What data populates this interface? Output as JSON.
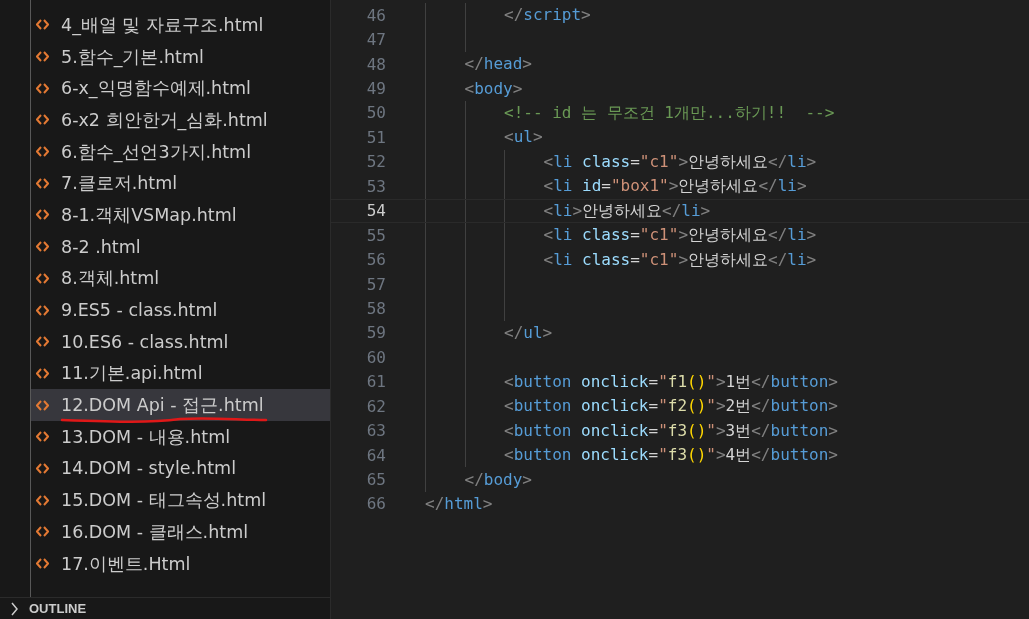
{
  "sidebar": {
    "files": [
      {
        "label": "4_배열 및 자료구조.html",
        "selected": false
      },
      {
        "label": "5.함수_기본.html",
        "selected": false
      },
      {
        "label": "6-x_익명함수예제.html",
        "selected": false
      },
      {
        "label": "6-x2 희안한거_심화.html",
        "selected": false
      },
      {
        "label": "6.함수_선언3가지.html",
        "selected": false
      },
      {
        "label": "7.클로저.html",
        "selected": false
      },
      {
        "label": "8-1.객체VSMap.html",
        "selected": false
      },
      {
        "label": "8-2 .html",
        "selected": false
      },
      {
        "label": "8.객체.html",
        "selected": false
      },
      {
        "label": "9.ES5 - class.html",
        "selected": false
      },
      {
        "label": "10.ES6 - class.html",
        "selected": false
      },
      {
        "label": "11.기본.api.html",
        "selected": false
      },
      {
        "label": "12.DOM Api - 접근.html",
        "selected": true
      },
      {
        "label": "13.DOM - 내용.html",
        "selected": false
      },
      {
        "label": "14.DOM - style.html",
        "selected": false
      },
      {
        "label": "15.DOM - 태그속성.html",
        "selected": false
      },
      {
        "label": "16.DOM - 클래스.html",
        "selected": false
      },
      {
        "label": "17.이벤트.Html",
        "selected": false
      }
    ],
    "outline": {
      "label": "OUTLINE",
      "expanded": false
    }
  },
  "editor": {
    "lines": [
      {
        "children": [
          {
            "children": [
              {
                "number": "46",
                "current": false,
                "tokens": [
                  {
                    "kind": "punct",
                    "text": "</"
                  },
                  {
                    "kind": "tag",
                    "text": "script"
                  },
                  {
                    "kind": "punct",
                    "text": ">"
                  }
                ]
              },
              {
                "number": "47",
                "current": false
              }
            ]
          },
          {
            "number": "48",
            "current": false,
            "tokens": [
              {
                "kind": "punct",
                "text": "</"
              },
              {
                "kind": "tag",
                "text": "head"
              },
              {
                "kind": "punct",
                "text": ">"
              }
            ]
          },
          {
            "number": "49",
            "current": false,
            "tokens": [
              {
                "kind": "punct",
                "text": "<"
              },
              {
                "kind": "tag",
                "text": "body"
              },
              {
                "kind": "punct",
                "text": ">"
              }
            ]
          },
          {
            "children": [
              {
                "number": "50",
                "current": false,
                "tokens": [
                  {
                    "kind": "comment",
                    "text": "<!-- id 는 무조건 1개만...하기!!  -->"
                  }
                ]
              },
              {
                "number": "51",
                "current": false,
                "tokens": [
                  {
                    "kind": "punct",
                    "text": "<"
                  },
                  {
                    "kind": "tag",
                    "text": "ul"
                  },
                  {
                    "kind": "punct",
                    "text": ">"
                  }
                ]
              },
              {
                "children": [
                  {
                    "number": "52",
                    "current": false,
                    "tokens": [
                      {
                        "kind": "punct",
                        "text": "<"
                      },
                      {
                        "kind": "tag",
                        "text": "li"
                      },
                      {
                        "kind": "attr",
                        "text": " class"
                      },
                      {
                        "kind": "plain",
                        "text": "="
                      },
                      {
                        "kind": "string",
                        "text": "\"c1\""
                      },
                      {
                        "kind": "punct",
                        "text": ">"
                      },
                      {
                        "kind": "plain",
                        "text": "안녕하세요"
                      },
                      {
                        "kind": "punct",
                        "text": "</"
                      },
                      {
                        "kind": "tag",
                        "text": "li"
                      },
                      {
                        "kind": "punct",
                        "text": ">"
                      }
                    ]
                  },
                  {
                    "number": "53",
                    "current": false,
                    "tokens": [
                      {
                        "kind": "punct",
                        "text": "<"
                      },
                      {
                        "kind": "tag",
                        "text": "li"
                      },
                      {
                        "kind": "attr",
                        "text": " id"
                      },
                      {
                        "kind": "plain",
                        "text": "="
                      },
                      {
                        "kind": "string",
                        "text": "\"box1\""
                      },
                      {
                        "kind": "punct",
                        "text": ">"
                      },
                      {
                        "kind": "plain",
                        "text": "안녕하세요"
                      },
                      {
                        "kind": "punct",
                        "text": "</"
                      },
                      {
                        "kind": "tag",
                        "text": "li"
                      },
                      {
                        "kind": "punct",
                        "text": ">"
                      }
                    ]
                  },
                  {
                    "number": "54",
                    "current": true,
                    "tokens": [
                      {
                        "kind": "punct",
                        "text": "<"
                      },
                      {
                        "kind": "tag",
                        "text": "li"
                      },
                      {
                        "kind": "punct",
                        "text": ">"
                      },
                      {
                        "kind": "plain",
                        "text": "안녕하세요"
                      },
                      {
                        "kind": "punct",
                        "text": "</"
                      },
                      {
                        "kind": "tag",
                        "text": "li"
                      },
                      {
                        "kind": "punct",
                        "text": ">"
                      }
                    ]
                  },
                  {
                    "number": "55",
                    "current": false,
                    "tokens": [
                      {
                        "kind": "punct",
                        "text": "<"
                      },
                      {
                        "kind": "tag",
                        "text": "li"
                      },
                      {
                        "kind": "attr",
                        "text": " class"
                      },
                      {
                        "kind": "plain",
                        "text": "="
                      },
                      {
                        "kind": "string",
                        "text": "\"c1\""
                      },
                      {
                        "kind": "punct",
                        "text": ">"
                      },
                      {
                        "kind": "plain",
                        "text": "안녕하세요"
                      },
                      {
                        "kind": "punct",
                        "text": "</"
                      },
                      {
                        "kind": "tag",
                        "text": "li"
                      },
                      {
                        "kind": "punct",
                        "text": ">"
                      }
                    ]
                  },
                  {
                    "number": "56",
                    "current": false,
                    "tokens": [
                      {
                        "kind": "punct",
                        "text": "<"
                      },
                      {
                        "kind": "tag",
                        "text": "li"
                      },
                      {
                        "kind": "attr",
                        "text": " class"
                      },
                      {
                        "kind": "plain",
                        "text": "="
                      },
                      {
                        "kind": "string",
                        "text": "\"c1\""
                      },
                      {
                        "kind": "punct",
                        "text": ">"
                      },
                      {
                        "kind": "plain",
                        "text": "안녕하세요"
                      },
                      {
                        "kind": "punct",
                        "text": "</"
                      },
                      {
                        "kind": "tag",
                        "text": "li"
                      },
                      {
                        "kind": "punct",
                        "text": ">"
                      }
                    ]
                  },
                  {
                    "number": "57",
                    "current": false
                  },
                  {
                    "number": "58",
                    "current": false
                  }
                ]
              },
              {
                "number": "59",
                "current": false,
                "tokens": [
                  {
                    "kind": "punct",
                    "text": "</"
                  },
                  {
                    "kind": "tag",
                    "text": "ul"
                  },
                  {
                    "kind": "punct",
                    "text": ">"
                  }
                ]
              },
              {
                "number": "60",
                "current": false
              },
              {
                "number": "61",
                "current": false,
                "tokens": [
                  {
                    "kind": "punct",
                    "text": "<"
                  },
                  {
                    "kind": "tag",
                    "text": "button"
                  },
                  {
                    "kind": "attr",
                    "text": " onclick"
                  },
                  {
                    "kind": "plain",
                    "text": "="
                  },
                  {
                    "kind": "string",
                    "text": "\""
                  },
                  {
                    "kind": "function",
                    "text": "f1"
                  },
                  {
                    "kind": "paren",
                    "text": "()"
                  },
                  {
                    "kind": "string",
                    "text": "\""
                  },
                  {
                    "kind": "punct",
                    "text": ">"
                  },
                  {
                    "kind": "plain",
                    "text": "1번"
                  },
                  {
                    "kind": "punct",
                    "text": "</"
                  },
                  {
                    "kind": "tag",
                    "text": "button"
                  },
                  {
                    "kind": "punct",
                    "text": ">"
                  }
                ]
              },
              {
                "number": "62",
                "current": false,
                "tokens": [
                  {
                    "kind": "punct",
                    "text": "<"
                  },
                  {
                    "kind": "tag",
                    "text": "button"
                  },
                  {
                    "kind": "attr",
                    "text": " onclick"
                  },
                  {
                    "kind": "plain",
                    "text": "="
                  },
                  {
                    "kind": "string",
                    "text": "\""
                  },
                  {
                    "kind": "function",
                    "text": "f2"
                  },
                  {
                    "kind": "paren",
                    "text": "()"
                  },
                  {
                    "kind": "string",
                    "text": "\""
                  },
                  {
                    "kind": "punct",
                    "text": ">"
                  },
                  {
                    "kind": "plain",
                    "text": "2번"
                  },
                  {
                    "kind": "punct",
                    "text": "</"
                  },
                  {
                    "kind": "tag",
                    "text": "button"
                  },
                  {
                    "kind": "punct",
                    "text": ">"
                  }
                ]
              },
              {
                "number": "63",
                "current": false,
                "tokens": [
                  {
                    "kind": "punct",
                    "text": "<"
                  },
                  {
                    "kind": "tag",
                    "text": "button"
                  },
                  {
                    "kind": "attr",
                    "text": " onclick"
                  },
                  {
                    "kind": "plain",
                    "text": "="
                  },
                  {
                    "kind": "string",
                    "text": "\""
                  },
                  {
                    "kind": "function",
                    "text": "f3"
                  },
                  {
                    "kind": "paren",
                    "text": "()"
                  },
                  {
                    "kind": "string",
                    "text": "\""
                  },
                  {
                    "kind": "punct",
                    "text": ">"
                  },
                  {
                    "kind": "plain",
                    "text": "3번"
                  },
                  {
                    "kind": "punct",
                    "text": "</"
                  },
                  {
                    "kind": "tag",
                    "text": "button"
                  },
                  {
                    "kind": "punct",
                    "text": ">"
                  }
                ]
              },
              {
                "number": "64",
                "current": false,
                "tokens": [
                  {
                    "kind": "punct",
                    "text": "<"
                  },
                  {
                    "kind": "tag",
                    "text": "button"
                  },
                  {
                    "kind": "attr",
                    "text": " onclick"
                  },
                  {
                    "kind": "plain",
                    "text": "="
                  },
                  {
                    "kind": "string",
                    "text": "\""
                  },
                  {
                    "kind": "function",
                    "text": "f3"
                  },
                  {
                    "kind": "paren",
                    "text": "()"
                  },
                  {
                    "kind": "string",
                    "text": "\""
                  },
                  {
                    "kind": "punct",
                    "text": ">"
                  },
                  {
                    "kind": "plain",
                    "text": "4번"
                  },
                  {
                    "kind": "punct",
                    "text": "</"
                  },
                  {
                    "kind": "tag",
                    "text": "button"
                  },
                  {
                    "kind": "punct",
                    "text": ">"
                  }
                ]
              }
            ]
          },
          {
            "number": "65",
            "current": false,
            "tokens": [
              {
                "kind": "punct",
                "text": "</"
              },
              {
                "kind": "tag",
                "text": "body"
              },
              {
                "kind": "punct",
                "text": ">"
              }
            ]
          }
        ]
      },
      {
        "number": "66",
        "current": false,
        "tokens": [
          {
            "kind": "punct",
            "text": "</"
          },
          {
            "kind": "tag",
            "text": "html"
          },
          {
            "kind": "punct",
            "text": ">"
          }
        ]
      }
    ]
  }
}
